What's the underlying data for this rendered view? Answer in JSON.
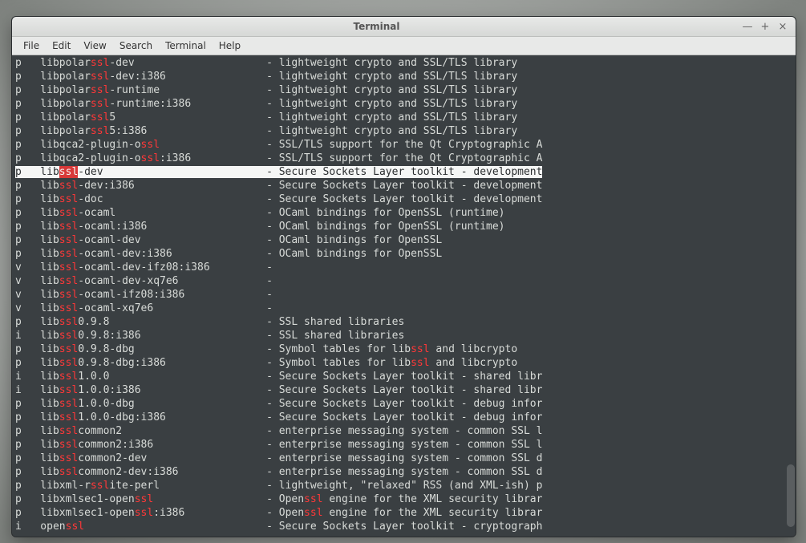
{
  "window": {
    "title": "Terminal"
  },
  "menubar": {
    "items": [
      "File",
      "Edit",
      "View",
      "Search",
      "Terminal",
      "Help"
    ]
  },
  "search_term": "ssl",
  "lines": [
    {
      "st": "p",
      "pre": "libpolar",
      "post": "-dev",
      "desc": "lightweight crypto and SSL/TLS library",
      "sel": false
    },
    {
      "st": "p",
      "pre": "libpolar",
      "post": "-dev:i386",
      "desc": "lightweight crypto and SSL/TLS library",
      "sel": false
    },
    {
      "st": "p",
      "pre": "libpolar",
      "post": "-runtime",
      "desc": "lightweight crypto and SSL/TLS library",
      "sel": false
    },
    {
      "st": "p",
      "pre": "libpolar",
      "post": "-runtime:i386",
      "desc": "lightweight crypto and SSL/TLS library",
      "sel": false
    },
    {
      "st": "p",
      "pre": "libpolar",
      "post": "5",
      "desc": "lightweight crypto and SSL/TLS library",
      "sel": false
    },
    {
      "st": "p",
      "pre": "libpolar",
      "post": "5:i386",
      "desc": "lightweight crypto and SSL/TLS library",
      "sel": false
    },
    {
      "st": "p",
      "pre": "libqca2-plugin-o",
      "post": "",
      "desc": "SSL/TLS support for the Qt Cryptographic A",
      "sel": false
    },
    {
      "st": "p",
      "pre": "libqca2-plugin-o",
      "post": ":i386",
      "desc": "SSL/TLS support for the Qt Cryptographic A",
      "sel": false
    },
    {
      "st": "p",
      "pre": "lib",
      "post": "-dev",
      "desc": "Secure Sockets Layer toolkit - development",
      "sel": true
    },
    {
      "st": "p",
      "pre": "lib",
      "post": "-dev:i386",
      "desc": "Secure Sockets Layer toolkit - development",
      "sel": false
    },
    {
      "st": "p",
      "pre": "lib",
      "post": "-doc",
      "desc": "Secure Sockets Layer toolkit - development",
      "sel": false
    },
    {
      "st": "p",
      "pre": "lib",
      "post": "-ocaml",
      "desc": "OCaml bindings for OpenSSL (runtime)",
      "sel": false
    },
    {
      "st": "p",
      "pre": "lib",
      "post": "-ocaml:i386",
      "desc": "OCaml bindings for OpenSSL (runtime)",
      "sel": false
    },
    {
      "st": "p",
      "pre": "lib",
      "post": "-ocaml-dev",
      "desc": "OCaml bindings for OpenSSL",
      "sel": false
    },
    {
      "st": "p",
      "pre": "lib",
      "post": "-ocaml-dev:i386",
      "desc": "OCaml bindings for OpenSSL",
      "sel": false
    },
    {
      "st": "v",
      "pre": "lib",
      "post": "-ocaml-dev-ifz08:i386",
      "desc": "",
      "sel": false
    },
    {
      "st": "v",
      "pre": "lib",
      "post": "-ocaml-dev-xq7e6",
      "desc": "",
      "sel": false
    },
    {
      "st": "v",
      "pre": "lib",
      "post": "-ocaml-ifz08:i386",
      "desc": "",
      "sel": false
    },
    {
      "st": "v",
      "pre": "lib",
      "post": "-ocaml-xq7e6",
      "desc": "",
      "sel": false
    },
    {
      "st": "p",
      "pre": "lib",
      "post": "0.9.8",
      "desc": "SSL shared libraries",
      "sel": false
    },
    {
      "st": "i",
      "pre": "lib",
      "post": "0.9.8:i386",
      "desc": "SSL shared libraries",
      "sel": false
    },
    {
      "st": "p",
      "pre": "lib",
      "post": "0.9.8-dbg",
      "desc": "Symbol tables for lib<hl> and libcrypto",
      "sel": false,
      "desc_hl": true
    },
    {
      "st": "p",
      "pre": "lib",
      "post": "0.9.8-dbg:i386",
      "desc": "Symbol tables for lib<hl> and libcrypto",
      "sel": false,
      "desc_hl": true
    },
    {
      "st": "i",
      "pre": "lib",
      "post": "1.0.0",
      "desc": "Secure Sockets Layer toolkit - shared libr",
      "sel": false
    },
    {
      "st": "i",
      "pre": "lib",
      "post": "1.0.0:i386",
      "desc": "Secure Sockets Layer toolkit - shared libr",
      "sel": false
    },
    {
      "st": "p",
      "pre": "lib",
      "post": "1.0.0-dbg",
      "desc": "Secure Sockets Layer toolkit - debug infor",
      "sel": false
    },
    {
      "st": "p",
      "pre": "lib",
      "post": "1.0.0-dbg:i386",
      "desc": "Secure Sockets Layer toolkit - debug infor",
      "sel": false
    },
    {
      "st": "p",
      "pre": "lib",
      "post": "common2",
      "desc": "enterprise messaging system - common SSL l",
      "sel": false
    },
    {
      "st": "p",
      "pre": "lib",
      "post": "common2:i386",
      "desc": "enterprise messaging system - common SSL l",
      "sel": false
    },
    {
      "st": "p",
      "pre": "lib",
      "post": "common2-dev",
      "desc": "enterprise messaging system - common SSL d",
      "sel": false
    },
    {
      "st": "p",
      "pre": "lib",
      "post": "common2-dev:i386",
      "desc": "enterprise messaging system - common SSL d",
      "sel": false
    },
    {
      "st": "p",
      "pre": "libxml-r",
      "post": "ite-perl",
      "desc": "lightweight, \"relaxed\" RSS (and XML-ish) p",
      "sel": false
    },
    {
      "st": "p",
      "pre": "libxmlsec1-open",
      "post": "",
      "desc": "Open<hl> engine for the XML security librar",
      "sel": false,
      "desc_hl": true
    },
    {
      "st": "p",
      "pre": "libxmlsec1-open",
      "post": ":i386",
      "desc": "Open<hl> engine for the XML security librar",
      "sel": false,
      "desc_hl": true
    },
    {
      "st": "i",
      "pre": "open",
      "post": "",
      "desc": "Secure Sockets Layer toolkit - cryptograph",
      "sel": false
    }
  ],
  "name_col_width": 36
}
